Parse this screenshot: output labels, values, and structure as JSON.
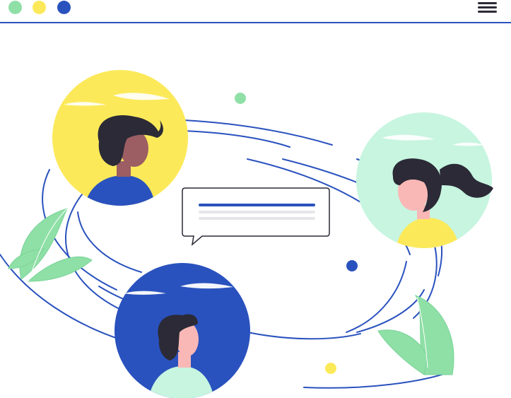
{
  "window_controls": {
    "dots": [
      {
        "name": "green",
        "color": "#8fe0a6"
      },
      {
        "name": "yellow",
        "color": "#fce95a"
      },
      {
        "name": "blue",
        "color": "#2a52be"
      }
    ]
  },
  "menu": {
    "icon": "hamburger-menu-icon"
  },
  "illustration": {
    "colors": {
      "accent_blue": "#2a52be",
      "yellow": "#fce95a",
      "mint": "#c7f5e0",
      "leaf_green": "#8fe0a6",
      "hair_dark": "#2b2a36",
      "skin_brown": "#9c5e62",
      "skin_pink": "#f9b8b6"
    },
    "avatars": [
      "avatar-man-yellow",
      "avatar-woman-mint",
      "avatar-man-blue"
    ],
    "chat_bubble": {
      "lines": 3
    }
  }
}
